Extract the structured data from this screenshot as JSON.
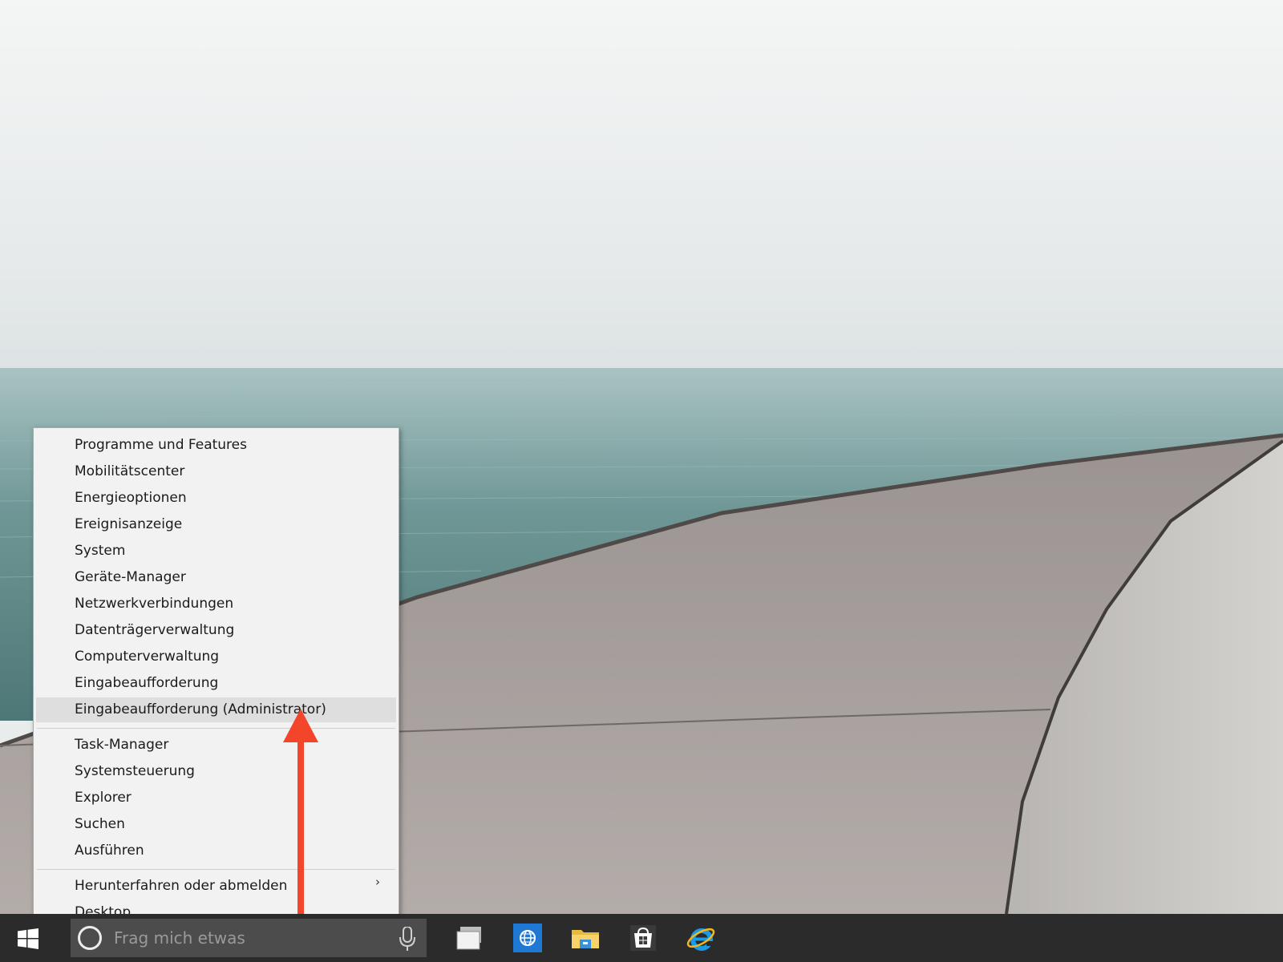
{
  "context_menu": {
    "groups": [
      [
        {
          "label": "Programme und Features",
          "highlighted": false
        },
        {
          "label": "Mobilitätscenter",
          "highlighted": false
        },
        {
          "label": "Energieoptionen",
          "highlighted": false
        },
        {
          "label": "Ereignisanzeige",
          "highlighted": false
        },
        {
          "label": "System",
          "highlighted": false
        },
        {
          "label": "Geräte-Manager",
          "highlighted": false
        },
        {
          "label": "Netzwerkverbindungen",
          "highlighted": false
        },
        {
          "label": "Datenträgerverwaltung",
          "highlighted": false
        },
        {
          "label": "Computerverwaltung",
          "highlighted": false
        },
        {
          "label": "Eingabeaufforderung",
          "highlighted": false
        },
        {
          "label": "Eingabeaufforderung (Administrator)",
          "highlighted": true
        }
      ],
      [
        {
          "label": "Task-Manager",
          "highlighted": false
        },
        {
          "label": "Systemsteuerung",
          "highlighted": false
        },
        {
          "label": "Explorer",
          "highlighted": false
        },
        {
          "label": "Suchen",
          "highlighted": false
        },
        {
          "label": "Ausführen",
          "highlighted": false
        }
      ],
      [
        {
          "label": "Herunterfahren oder abmelden",
          "highlighted": false,
          "submenu": true,
          "submenu_glyph": "›"
        },
        {
          "label": "Desktop",
          "highlighted": false
        }
      ]
    ]
  },
  "taskbar": {
    "search": {
      "placeholder": "Frag mich etwas",
      "value": ""
    },
    "pinned_apps": [
      "task-view-icon",
      "globe-app-icon",
      "file-explorer-icon",
      "store-icon",
      "internet-explorer-icon"
    ]
  },
  "annotation": {
    "arrow_color": "#f2452a"
  },
  "colors": {
    "taskbar": "#2b2b2b",
    "search_box": "#4c4c4c",
    "menu_background": "#f2f2f2",
    "menu_highlight": "#dedede",
    "accent_blue": "#1e78d4"
  }
}
